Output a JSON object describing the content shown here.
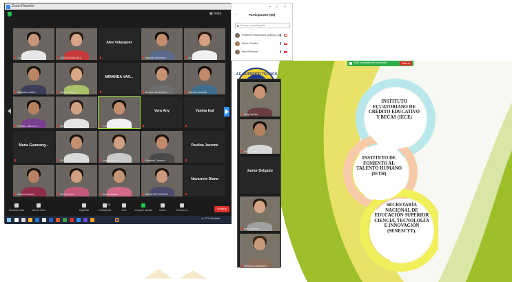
{
  "zoom_window": {
    "title": "Zoom Reunión",
    "view_label": "Vista",
    "tiles": [
      {
        "name": "Jonathan Daniel Ledes...",
        "type": "video",
        "skin": "#c79676",
        "hair": "#1b1410",
        "shirt": "#e8e8e8"
      },
      {
        "name": "JESSICA MARCELA",
        "type": "video",
        "skin": "#d8a588",
        "hair": "#2a1a12",
        "shirt": "#c73a3a"
      },
      {
        "name": "Alex Velasquez",
        "type": "name"
      },
      {
        "name": "Nathalie Villacreses",
        "type": "video",
        "skin": "#c48e6e",
        "hair": "#140e0b",
        "shirt": "#5b6b8c"
      },
      {
        "name": "Gloriela Aguilar",
        "type": "video",
        "skin": "#d5a080",
        "hair": "#2c1a10",
        "shirt": "#f0f0f0"
      },
      {
        "name": "Alejandra Lisbeth...",
        "type": "video",
        "skin": "#b98566",
        "hair": "#18100c",
        "shirt": "#3b3b5a"
      },
      {
        "name": "Yeshen Delgado",
        "type": "video",
        "skin": "#d9a887",
        "hair": "#3a2515",
        "shirt": "#a9c26a"
      },
      {
        "name": "MIRANDA VAR...",
        "type": "name"
      },
      {
        "name": "Andrea Lissette Bern...",
        "type": "video",
        "skin": "#c69373",
        "hair": "#20140e",
        "shirt": "#6d6d6d"
      },
      {
        "name": "Yasmani Jaramillo",
        "type": "video",
        "skin": "#c08a6a",
        "hair": "#150f0b",
        "shirt": "#3f6f8f"
      },
      {
        "name": "P-Ebbie...clas de s...",
        "type": "video",
        "skin": "#b7805f",
        "hair": "#1a110d",
        "shirt": "#7a3f8f"
      },
      {
        "name": "Karen Vera Ponce",
        "type": "video",
        "skin": "#d2a284",
        "hair": "#2b1b12",
        "shirt": "#e4e4e4"
      },
      {
        "name": "Junior Charlie...",
        "type": "video",
        "skin": "#c58f6d",
        "hair": "#161009",
        "shirt": "#f2f2f2",
        "active": true
      },
      {
        "name": "Vera Any",
        "type": "name"
      },
      {
        "name": "Yanina leal",
        "type": "name"
      },
      {
        "name": "Maria Guamang...",
        "type": "name"
      },
      {
        "name": "GREGORI ANGEL GUILLEN",
        "type": "video",
        "skin": "#c48f70",
        "hair": "#1c120d",
        "shirt": "#dadada"
      },
      {
        "name": "Angiee Lisseth",
        "type": "video",
        "skin": "#d1a083",
        "hair": "#24160f",
        "shirt": "#c9c9c9"
      },
      {
        "name": "Valentina Carrasco",
        "type": "video",
        "skin": "#c18b6b",
        "hair": "#1a110c",
        "shirt": "#4a4a4a"
      },
      {
        "name": "Paulina Jacome",
        "type": "name"
      },
      {
        "name": "Milston Alvarado",
        "type": "video",
        "skin": "#b98262",
        "hair": "#181009",
        "shirt": "#8f2d4a"
      },
      {
        "name": "Shirley Pecho",
        "type": "video",
        "skin": "#d0a083",
        "hair": "#22160f",
        "shirt": "#c25a7a"
      },
      {
        "name": "Ariana Salazar",
        "type": "video",
        "skin": "#c69575",
        "hair": "#1e140e",
        "shirt": "#d36a8a"
      },
      {
        "name": "SARAH DE VALLEJO",
        "type": "video",
        "skin": "#cc9a7b",
        "hair": "#20140d",
        "shirt": "#4a4a6a"
      },
      {
        "name": "Navarrete Diana",
        "type": "name"
      }
    ],
    "toolbar": [
      {
        "label": "Reactivar audio",
        "icon": "microphone-icon"
      },
      {
        "label": "Detener video",
        "icon": "video-camera-icon"
      },
      {
        "label": "Seguridad",
        "icon": "shield-icon"
      },
      {
        "label": "Participantes",
        "icon": "participants-icon",
        "count": "55"
      },
      {
        "label": "Chat",
        "icon": "chat-icon"
      },
      {
        "label": "Compartir pantalla",
        "icon": "share-screen-icon"
      },
      {
        "label": "Grabar",
        "icon": "record-icon"
      },
      {
        "label": "Reacciones",
        "icon": "reactions-icon"
      }
    ],
    "end_label": "Finalizar",
    "taskbar": {
      "weather": "27°C Nublado"
    }
  },
  "participants_panel": {
    "title": "Participantes (55)",
    "search_placeholder": "Buscar un participante",
    "rows": [
      {
        "name": "ROBERTO SANTIAGO (Anfitrión, yo)",
        "avatar": "#7a6a5a"
      },
      {
        "name": "Nelson Charles",
        "avatar": "#a07a5c"
      },
      {
        "name": "Neto Pastorano",
        "avatar": "#8c6c5a"
      }
    ]
  },
  "shared_screen": {
    "share_bar_text": "Está compartiendo la pantalla",
    "stop_label": "Parar el",
    "seal_text": "U.E. SUPERIOR TÉCNICO",
    "strip_tiles": [
      {
        "name": "Lesly Carolina",
        "type": "video",
        "skin": "#c99575",
        "hair": "#1d130d",
        "shirt": "#6b3f3f"
      },
      {
        "name": "Anita Quevedo",
        "type": "video",
        "skin": "#b7825f",
        "hair": "#1a110c",
        "shirt": "#d8d8d8"
      },
      {
        "name": "Junior Delgado",
        "type": "name"
      },
      {
        "name": "Keily Zambrano",
        "type": "video",
        "skin": "#d3a485",
        "hair": "#2a1b12",
        "shirt": "#a0a0a0"
      },
      {
        "name": "GENESIS ZAMBRANO",
        "type": "video",
        "skin": "#c8997a",
        "hair": "#3a2616",
        "shirt": "#8c6c5c"
      }
    ],
    "diagram": {
      "nodes": [
        {
          "text": "INSTITUTO ECUATORIANO DE CRÉDITO EDUCATIVO Y BECAS (IECE)",
          "color": "#b9e8ec"
        },
        {
          "text": "INSTITUTO DE FOMENTO AL TALENTO HUMANO (IFTH)",
          "color": "#f6caa8"
        },
        {
          "text": "SECRETARÍA NACIONAL DE EDUCACIÓN SUPERIOR CIENCIA, TECNOLOGÍA E INNOVACIÓN (SENESCYT).",
          "color": "#f1ef5a"
        }
      ]
    },
    "colors": {
      "swoosh_green": "#9dbf2a",
      "swoosh_yellow": "#e9e26a",
      "swoosh_light": "#d9e6a6"
    }
  }
}
